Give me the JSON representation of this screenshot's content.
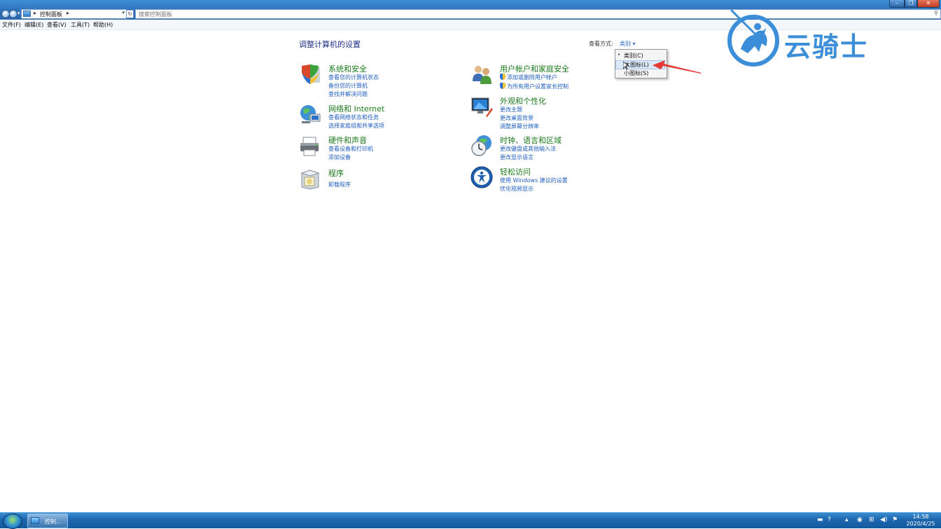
{
  "window": {
    "address": {
      "crumb": "控制面板"
    },
    "search": {
      "placeholder": "搜索控制面板"
    }
  },
  "menubar": [
    "文件(F)",
    "编辑(E)",
    "查看(V)",
    "工具(T)",
    "帮助(H)"
  ],
  "page": {
    "title": "调整计算机的设置",
    "view_by_label": "查看方式:",
    "view_by_value": "类别 ▾"
  },
  "view_menu": {
    "options": [
      "类别(C)",
      "大图标(L)",
      "小图标(S)"
    ],
    "selected": "类别(C)",
    "highlighted": "大图标(L)"
  },
  "categories_left": [
    {
      "title": "系统和安全",
      "links": [
        "查看您的计算机状态",
        "备份您的计算机",
        "查找并解决问题"
      ]
    },
    {
      "title": "网络和 Internet",
      "links": [
        "查看网络状态和任务",
        "选择家庭组和共享选项"
      ]
    },
    {
      "title": "硬件和声音",
      "links": [
        "查看设备和打印机",
        "添加设备"
      ]
    },
    {
      "title": "程序",
      "links": [
        "卸载程序"
      ]
    }
  ],
  "categories_right": [
    {
      "title": "用户帐户和家庭安全",
      "links": [
        "添加或删除用户帐户",
        "为所有用户设置家长控制"
      ]
    },
    {
      "title": "外观和个性化",
      "links": [
        "更改主题",
        "更改桌面背景",
        "调整屏幕分辨率"
      ]
    },
    {
      "title": "时钟、语言和区域",
      "links": [
        "更改键盘或其他输入法",
        "更改显示语言"
      ]
    },
    {
      "title": "轻松访问",
      "links": [
        "使用 Windows 建议的设置",
        "优化视频显示"
      ]
    }
  ],
  "watermark": {
    "text": "云骑士"
  },
  "taskbar": {
    "task_label": "控制...",
    "clock_time": "14:58",
    "clock_date": "2020/4/25"
  },
  "colors": {
    "category_title": "#1b7a1b",
    "link": "#1f5fbf",
    "page_title": "#1e3287",
    "annotation_arrow": "#e53935"
  }
}
